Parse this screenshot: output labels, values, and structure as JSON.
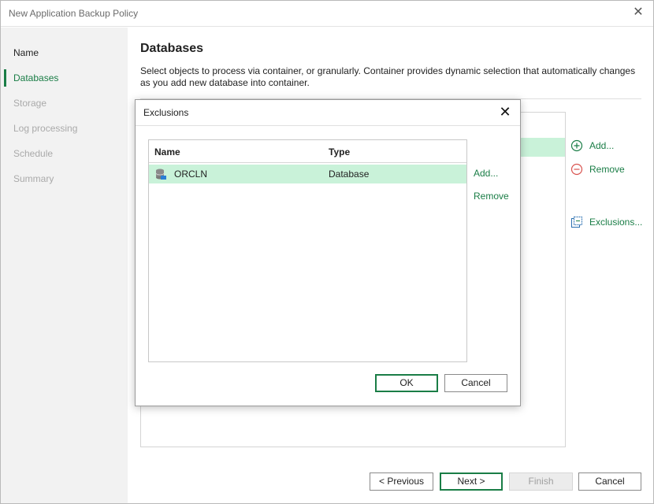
{
  "window": {
    "title": "New Application Backup Policy",
    "close_glyph": "✕"
  },
  "sidebar": {
    "steps": [
      {
        "label": "Name",
        "state": "done"
      },
      {
        "label": "Databases",
        "state": "active"
      },
      {
        "label": "Storage",
        "state": "pending"
      },
      {
        "label": "Log processing",
        "state": "pending"
      },
      {
        "label": "Schedule",
        "state": "pending"
      },
      {
        "label": "Summary",
        "state": "pending"
      }
    ]
  },
  "main": {
    "heading": "Databases",
    "description": "Select objects to process via container, or granularly. Container provides dynamic selection that automatically changes as you add new database into container.",
    "actions": {
      "add": "Add...",
      "remove": "Remove",
      "exclusions": "Exclusions..."
    }
  },
  "footer": {
    "previous": "< Previous",
    "next": "Next >",
    "finish": "Finish",
    "cancel": "Cancel"
  },
  "modal": {
    "title": "Exclusions",
    "close_glyph": "✕",
    "columns": {
      "name": "Name",
      "type": "Type"
    },
    "rows": [
      {
        "name": "ORCLN",
        "type": "Database",
        "icon": "database-icon",
        "selected": true
      }
    ],
    "add": "Add...",
    "remove": "Remove",
    "ok": "OK",
    "cancel": "Cancel"
  },
  "colors": {
    "accent": "#1a7d46",
    "selection": "#c9f2d9",
    "sidebar_bg": "#f2f2f2",
    "remove_red": "#d9534f"
  }
}
